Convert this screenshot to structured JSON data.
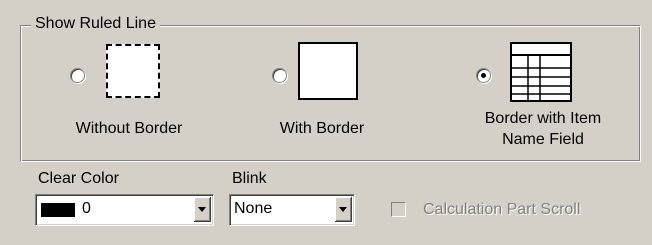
{
  "ruled_line": {
    "title": "Show Ruled Line",
    "options": [
      {
        "label": "Without Border",
        "selected": false,
        "preview": "dashed-border-icon"
      },
      {
        "label": "With Border",
        "selected": false,
        "preview": "solid-border-icon"
      },
      {
        "label_line1": "Border with Item",
        "label_line2": "Name Field",
        "selected": true,
        "preview": "grid-table-icon"
      }
    ]
  },
  "clear_color": {
    "label": "Clear Color",
    "value": "0",
    "swatch_color": "#000000"
  },
  "blink": {
    "label": "Blink",
    "value": "None"
  },
  "calc_scroll": {
    "label": "Calculation Part Scroll",
    "checked": false,
    "enabled": false
  }
}
